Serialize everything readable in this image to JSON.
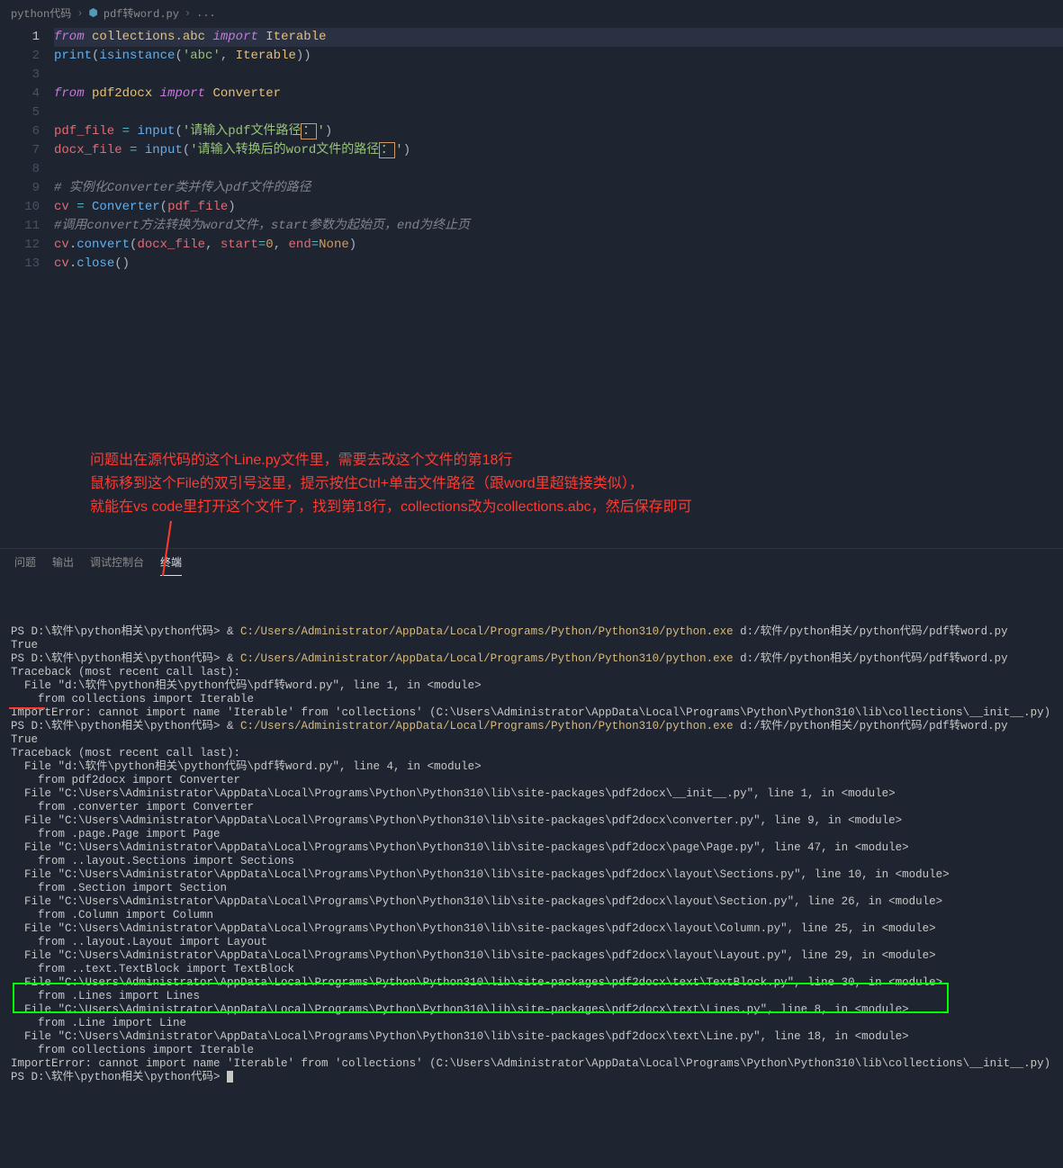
{
  "breadcrumb": {
    "parts": [
      "python代码",
      "pdf转word.py",
      "..."
    ]
  },
  "code": {
    "lines": [
      {
        "n": 1,
        "hl": true,
        "tokens": [
          [
            "kw",
            "from"
          ],
          [
            "punc",
            " "
          ],
          [
            "mod",
            "collections"
          ],
          [
            "punc",
            "."
          ],
          [
            "mod",
            "abc"
          ],
          [
            "punc",
            " "
          ],
          [
            "kw",
            "import"
          ],
          [
            "punc",
            " "
          ],
          [
            "mod",
            "Iterable"
          ]
        ]
      },
      {
        "n": 2,
        "tokens": [
          [
            "fn",
            "print"
          ],
          [
            "punc",
            "("
          ],
          [
            "fn",
            "isinstance"
          ],
          [
            "punc",
            "("
          ],
          [
            "str",
            "'abc'"
          ],
          [
            "punc",
            ", "
          ],
          [
            "mod",
            "Iterable"
          ],
          [
            "punc",
            "))"
          ]
        ]
      },
      {
        "n": 3,
        "tokens": []
      },
      {
        "n": 4,
        "tokens": [
          [
            "kw",
            "from"
          ],
          [
            "punc",
            " "
          ],
          [
            "mod",
            "pdf2docx"
          ],
          [
            "punc",
            " "
          ],
          [
            "kw",
            "import"
          ],
          [
            "punc",
            " "
          ],
          [
            "mod",
            "Converter"
          ]
        ]
      },
      {
        "n": 5,
        "tokens": []
      },
      {
        "n": 6,
        "tokens": [
          [
            "var",
            "pdf_file"
          ],
          [
            "punc",
            " "
          ],
          [
            "op",
            "="
          ],
          [
            "punc",
            " "
          ],
          [
            "fn",
            "input"
          ],
          [
            "punc",
            "("
          ],
          [
            "str",
            "'请输入pdf文件路径"
          ],
          [
            "hlbox",
            "："
          ],
          [
            "str",
            "'"
          ],
          [
            "punc",
            ")"
          ]
        ]
      },
      {
        "n": 7,
        "tokens": [
          [
            "var",
            "docx_file"
          ],
          [
            "punc",
            " "
          ],
          [
            "op",
            "="
          ],
          [
            "punc",
            " "
          ],
          [
            "fn",
            "input"
          ],
          [
            "punc",
            "("
          ],
          [
            "str",
            "'请输入转换后的word文件的路径"
          ],
          [
            "hlbox",
            "："
          ],
          [
            "str",
            "'"
          ],
          [
            "punc",
            ")"
          ]
        ]
      },
      {
        "n": 8,
        "tokens": []
      },
      {
        "n": 9,
        "tokens": [
          [
            "cmt",
            "# 实例化Converter类并传入pdf文件的路径"
          ]
        ]
      },
      {
        "n": 10,
        "tokens": [
          [
            "var",
            "cv"
          ],
          [
            "punc",
            " "
          ],
          [
            "op",
            "="
          ],
          [
            "punc",
            " "
          ],
          [
            "fn",
            "Converter"
          ],
          [
            "punc",
            "("
          ],
          [
            "var",
            "pdf_file"
          ],
          [
            "punc",
            ")"
          ]
        ]
      },
      {
        "n": 11,
        "tokens": [
          [
            "cmt",
            "#调用convert方法转换为word文件，start参数为起始页，end为终止页"
          ]
        ]
      },
      {
        "n": 12,
        "tokens": [
          [
            "var",
            "cv"
          ],
          [
            "punc",
            "."
          ],
          [
            "fn",
            "convert"
          ],
          [
            "punc",
            "("
          ],
          [
            "var",
            "docx_file"
          ],
          [
            "punc",
            ", "
          ],
          [
            "var",
            "start"
          ],
          [
            "op",
            "="
          ],
          [
            "num",
            "0"
          ],
          [
            "punc",
            ", "
          ],
          [
            "var",
            "end"
          ],
          [
            "op",
            "="
          ],
          [
            "const",
            "None"
          ],
          [
            "punc",
            ")"
          ]
        ]
      },
      {
        "n": 13,
        "tokens": [
          [
            "var",
            "cv"
          ],
          [
            "punc",
            "."
          ],
          [
            "fn",
            "close"
          ],
          [
            "punc",
            "()"
          ]
        ]
      }
    ]
  },
  "annotation": {
    "line1": "问题出在源代码的这个Line.py文件里，需要去改这个文件的第18行",
    "line2": "鼠标移到这个File的双引号这里，提示按住Ctrl+单击文件路径（跟word里超链接类似），",
    "line3": "就能在vs code里打开这个文件了，找到第18行，collections改为collections.abc，然后保存即可"
  },
  "panel": {
    "tabs": [
      "问题",
      "输出",
      "调试控制台",
      "终端"
    ],
    "active": 3
  },
  "terminal": {
    "t0": "PS D:\\软件\\python相关\\python代码> & ",
    "exe": "C:/Users/Administrator/AppData/Local/Programs/Python/Python310/python.exe",
    "arg": " d:/软件/python相关/python代码/pdf转word.py",
    "true": "True",
    "tb": "Traceback (most recent call last):",
    "f1": "  File \"d:\\软件\\python相关\\python代码\\pdf转word.py\", line 1, in <module>",
    "i1": "    from collections import Iterable",
    "err1": "ImportError: cannot import name 'Iterable' from 'collections' (C:\\Users\\Administrator\\AppData\\Local\\Programs\\Python\\Python310\\lib\\collections\\__init__.py)",
    "f4": "  File \"d:\\软件\\python相关\\python代码\\pdf转word.py\", line 4, in <module>",
    "i4": "    from pdf2docx import Converter",
    "f_init": "  File \"C:\\Users\\Administrator\\AppData\\Local\\Programs\\Python\\Python310\\lib\\site-packages\\pdf2docx\\__init__.py\", line 1, in <module>",
    "i_init": "    from .converter import Converter",
    "f_conv": "  File \"C:\\Users\\Administrator\\AppData\\Local\\Programs\\Python\\Python310\\lib\\site-packages\\pdf2docx\\converter.py\", line 9, in <module>",
    "i_conv": "    from .page.Page import Page",
    "f_page": "  File \"C:\\Users\\Administrator\\AppData\\Local\\Programs\\Python\\Python310\\lib\\site-packages\\pdf2docx\\page\\Page.py\", line 47, in <module>",
    "i_page": "    from ..layout.Sections import Sections",
    "f_sects": "  File \"C:\\Users\\Administrator\\AppData\\Local\\Programs\\Python\\Python310\\lib\\site-packages\\pdf2docx\\layout\\Sections.py\", line 10, in <module>",
    "i_sects": "    from .Section import Section",
    "f_sect": "  File \"C:\\Users\\Administrator\\AppData\\Local\\Programs\\Python\\Python310\\lib\\site-packages\\pdf2docx\\layout\\Section.py\", line 26, in <module>",
    "i_sect": "    from .Column import Column",
    "f_col": "  File \"C:\\Users\\Administrator\\AppData\\Local\\Programs\\Python\\Python310\\lib\\site-packages\\pdf2docx\\layout\\Column.py\", line 25, in <module>",
    "i_col": "    from ..layout.Layout import Layout",
    "f_lay": "  File \"C:\\Users\\Administrator\\AppData\\Local\\Programs\\Python\\Python310\\lib\\site-packages\\pdf2docx\\layout\\Layout.py\", line 29, in <module>",
    "i_lay": "    from ..text.TextBlock import TextBlock",
    "f_tb": "  File \"C:\\Users\\Administrator\\AppData\\Local\\Programs\\Python\\Python310\\lib\\site-packages\\pdf2docx\\text\\TextBlock.py\", line 30, in <module>",
    "i_tb": "    from .Lines import Lines",
    "f_lines": "  File \"C:\\Users\\Administrator\\AppData\\Local\\Programs\\Python\\Python310\\lib\\site-packages\\pdf2docx\\text\\Lines.py\", line 8, in <module>",
    "i_lines": "    from .Line import Line",
    "f_line": "  File \"C:\\Users\\Administrator\\AppData\\Local\\Programs\\Python\\Python310\\lib\\site-packages\\pdf2docx\\text\\Line.py\", line 18, in <module>",
    "i_line": "    from collections import Iterable",
    "err2": "ImportError: cannot import name 'Iterable' from 'collections' (C:\\Users\\Administrator\\AppData\\Local\\Programs\\Python\\Python310\\lib\\collections\\__init__.py)",
    "final": "PS D:\\软件\\python相关\\python代码> "
  }
}
